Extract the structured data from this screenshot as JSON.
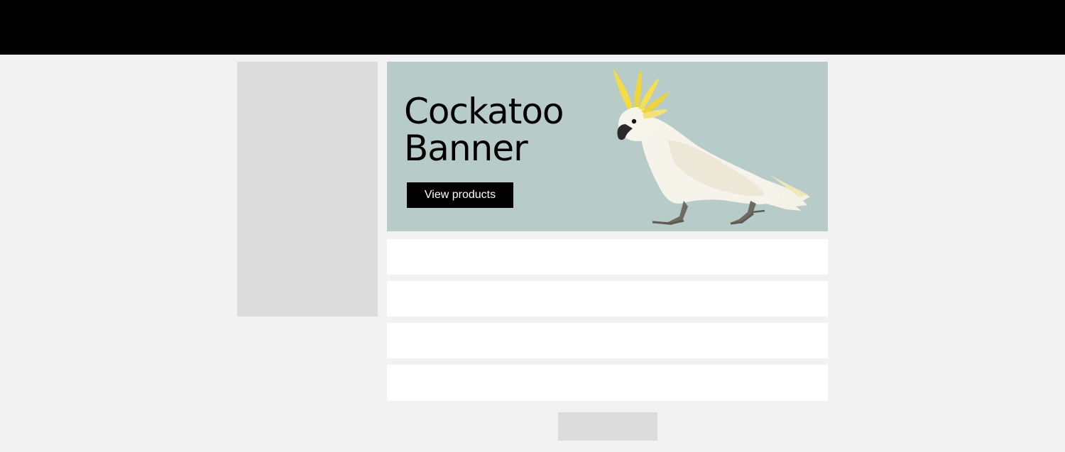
{
  "banner": {
    "title_line1": "Cockatoo",
    "title_line2": "Banner",
    "cta_label": "View products",
    "background_color": "#b7cbc8",
    "image": "cockatoo-image"
  },
  "colors": {
    "topbar": "#000000",
    "page_background": "#f2f2f2",
    "placeholder": "#dcdcdc",
    "card": "#ffffff"
  }
}
